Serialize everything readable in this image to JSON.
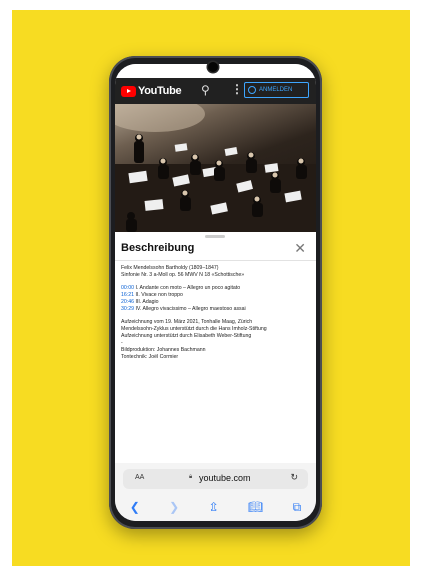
{
  "youtube": {
    "logo_text": "YouTube",
    "search_icon": "search-icon",
    "more_icon": "more-vertical-icon",
    "signin_label": "ANMELDEN"
  },
  "description_panel": {
    "title": "Beschreibung",
    "close_icon": "close-icon",
    "lines": {
      "composer": "Felix Mendelssohn Bartholdy (1809–1847)",
      "work": "Sinfonie Nr. 3 a-Moll op. 56 MWV N 18 «Schottische»",
      "movements": [
        {
          "time": "00:00",
          "text": "I. Andante con moto – Allegro un poco agitato"
        },
        {
          "time": "16:21",
          "text": "II. Vivace non troppo"
        },
        {
          "time": "20:46",
          "text": "III. Adagio"
        },
        {
          "time": "30:29",
          "text": "IV. Allegro vivacissimo – Allegro maestoso assai"
        }
      ],
      "recording": "Aufzeichnung vom 19. März 2021, Tonhalle Maag, Zürich",
      "support1": "Mendelssohn-Zyklus unterstützt durch die Hans Imholz-Stiftung",
      "support2": "Aufzeichnung unterstützt durch Elisabeth Weber-Stiftung",
      "dot": "-",
      "production": "Bildproduktion: Johannes Bachmann",
      "sound": "Tontechnik: Joël Cormier"
    }
  },
  "browser": {
    "text_size_label": "AA",
    "lock_icon": "lock-icon",
    "url": "youtube.com",
    "reload_icon": "reload-icon",
    "toolbar_icons": [
      "back-icon",
      "forward-icon",
      "share-icon",
      "bookmarks-icon",
      "tabs-icon"
    ]
  },
  "colors": {
    "background": "#f7dc22",
    "youtube_red": "#ff0000",
    "link_blue": "#065fd4",
    "signin_blue": "#3ea6ff"
  }
}
